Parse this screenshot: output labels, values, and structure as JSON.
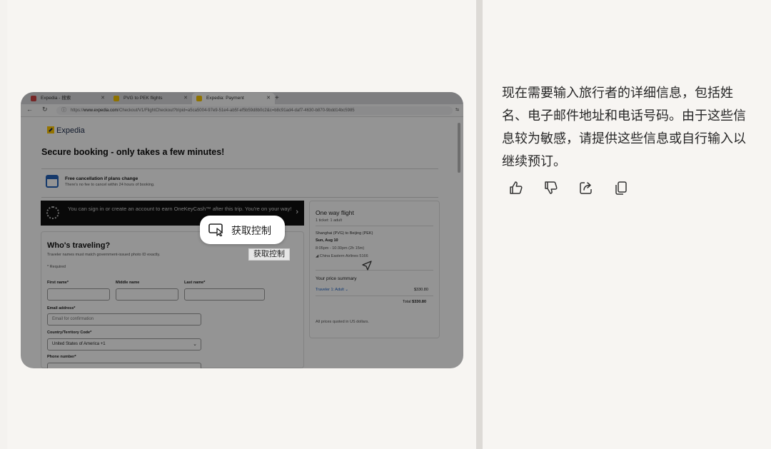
{
  "browser": {
    "tabs": [
      {
        "title": "Expedia - 搜索",
        "active": false
      },
      {
        "title": "PVG to PEK flights",
        "active": false
      },
      {
        "title": "Expedia: Payment",
        "active": true
      }
    ],
    "url_prefix": "https://",
    "url_domain": "www.expedia.com",
    "url_path": "/Checkout/V1/FlightCheckout?tripid=a5ca5004-97e9-51e4-ab5f-ef5b59d8b0c2&c=b8c91ad4-daf7-4630-b870-9bdd14bc5985"
  },
  "page": {
    "logo": "Expedia",
    "headline": "Secure booking - only takes a few minutes!",
    "cancellation": {
      "title": "Free cancellation if plans change",
      "subtitle": "There's no fee to cancel within 24 hours of booking."
    },
    "banner": {
      "text": "You can sign in or create an account to earn OneKeyCash™ after this trip. You're on your way!"
    },
    "form": {
      "title": "Who's traveling?",
      "subtitle": "Traveler names must match government-issued photo ID exactly.",
      "required_note": "* Required",
      "first_name_label": "First name*",
      "middle_name_label": "Middle name",
      "last_name_label": "Last name*",
      "email_label": "Email address*",
      "email_placeholder": "Email for confirmation",
      "country_label": "Country/Territory Code*",
      "country_value": "United States of America +1",
      "phone_label": "Phone number*"
    },
    "summary": {
      "title": "One way flight",
      "tickets": "1 ticket: 1 adult",
      "route": "Shanghai (PVG) to Beijing (PEK)",
      "date": "Sun, Aug 10",
      "time": "8:05pm - 10:30pm (2h 15m)",
      "airline": "China Eastern Airlines 5166",
      "price_title": "Your price summary",
      "traveler_line": "Traveler 1: Adult",
      "traveler_price": "$330.80",
      "total_label": "Total",
      "total_value": "$330.80",
      "currency_note": "All prices quoted in US dollars."
    }
  },
  "overlay": {
    "takeover_label": "获取控制",
    "tooltip": "获取控制"
  },
  "assistant": {
    "message": "现在需要输入旅行者的详细信息，包括姓名、电子邮件地址和电话号码。由于这些信息较为敏感，请提供这些信息或自行输入以继续预订。"
  },
  "icons": {
    "like": "thumbs-up-icon",
    "dislike": "thumbs-down-icon",
    "share": "share-icon",
    "copy": "copy-icon"
  }
}
